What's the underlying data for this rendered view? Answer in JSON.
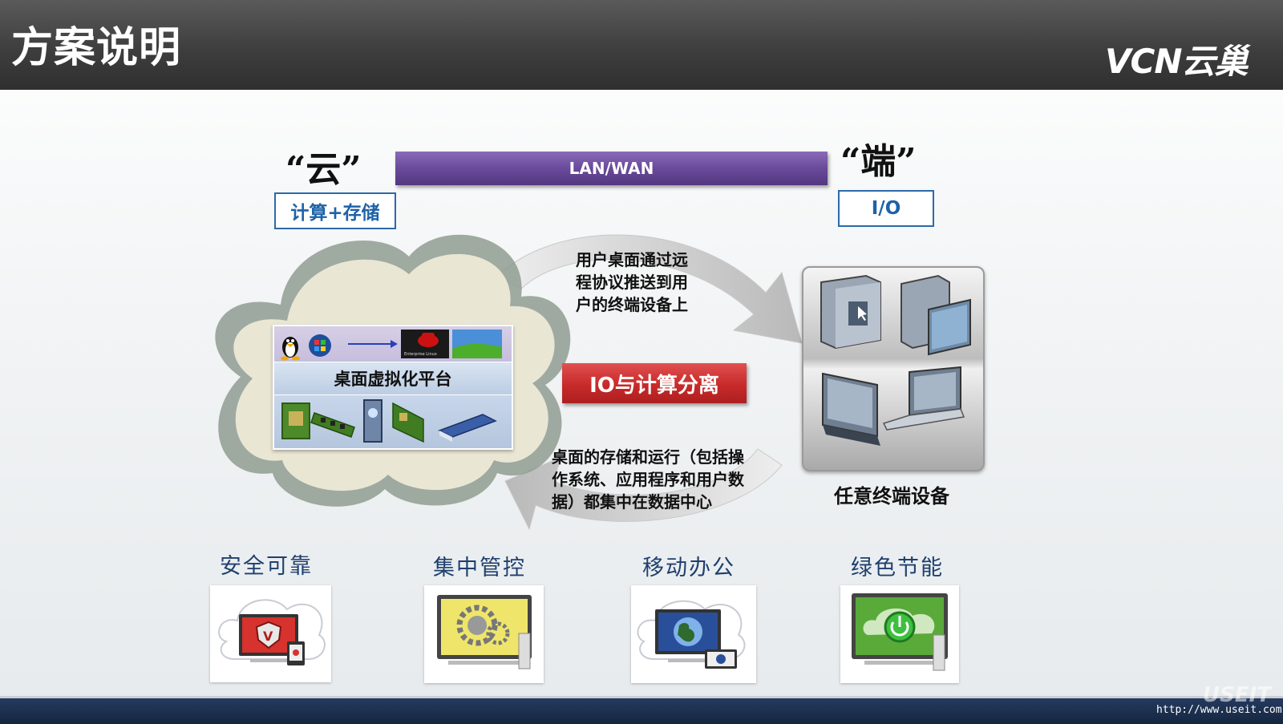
{
  "header": {
    "title": "方案说明",
    "logo": "VCN云巢"
  },
  "cloud": {
    "title": "“云”",
    "subtitle": "计算+存储",
    "platform_label": "桌面虚拟化平台",
    "os_badge": "Enterprise Linux"
  },
  "network": {
    "label": "LAN/WAN"
  },
  "endpoint": {
    "title": "“端”",
    "subtitle": "I/O",
    "caption": "任意终端设备"
  },
  "arrows": {
    "push_lines": [
      "用户桌面通过远",
      "程协议推送到用",
      "户的终端设备上"
    ],
    "storage_lines": [
      "桌面的存储和运行（包括操",
      "作系统、应用程序和用户数",
      "据）都集中在数据中心"
    ]
  },
  "separation_label": "IO与计算分离",
  "features": [
    {
      "label": "安全可靠",
      "icon": "shield-icon",
      "color": "#d6322e"
    },
    {
      "label": "集中管控",
      "icon": "gears-icon",
      "color": "#efe56a"
    },
    {
      "label": "移动办公",
      "icon": "globe-icon",
      "color": "#2a4f9a"
    },
    {
      "label": "绿色节能",
      "icon": "power-icon",
      "color": "#5aaa3a"
    }
  ],
  "footer": {
    "url": "http://www.useit.com.cn",
    "watermark": "USEIT"
  },
  "colors": {
    "header": "#3e3e3e",
    "lanwan": "#6a4a9a",
    "separation": "#c82a2a",
    "box_border": "#2b6aa8",
    "footer": "#1c2f50"
  }
}
